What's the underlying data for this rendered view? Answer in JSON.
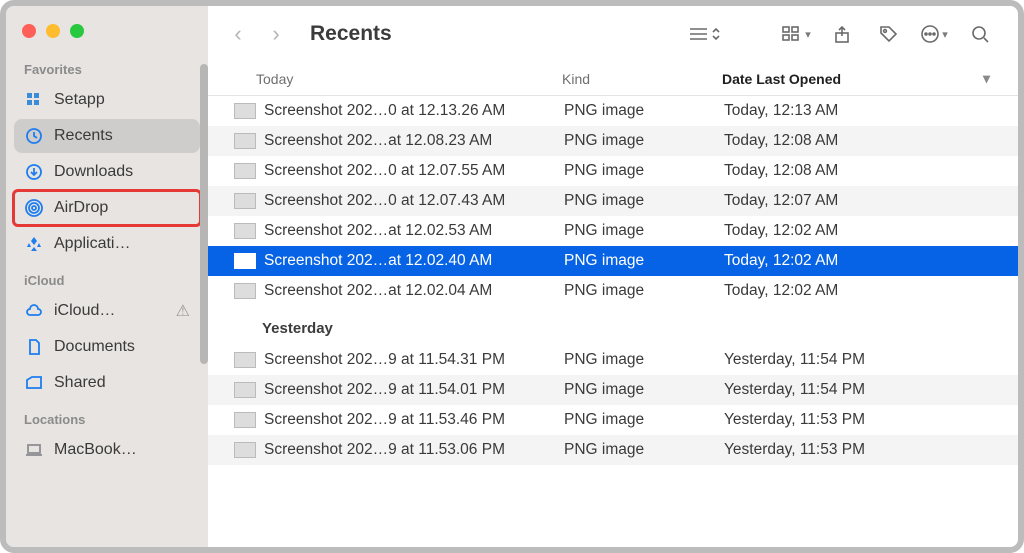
{
  "window_title": "Recents",
  "sidebar": {
    "sections": [
      {
        "label": "Favorites",
        "items": [
          {
            "icon": "setapp",
            "label": "Setapp",
            "active": false
          },
          {
            "icon": "clock",
            "label": "Recents",
            "active": true
          },
          {
            "icon": "download",
            "label": "Downloads",
            "active": false
          },
          {
            "icon": "airdrop",
            "label": "AirDrop",
            "active": false,
            "highlight": true
          },
          {
            "icon": "apps",
            "label": "Applicati…",
            "active": false
          }
        ]
      },
      {
        "label": "iCloud",
        "items": [
          {
            "icon": "cloud",
            "label": "iCloud…",
            "active": false,
            "warn": true
          },
          {
            "icon": "doc",
            "label": "Documents",
            "active": false
          },
          {
            "icon": "shared",
            "label": "Shared",
            "active": false
          }
        ]
      },
      {
        "label": "Locations",
        "items": [
          {
            "icon": "laptop",
            "label": "MacBook…",
            "active": false,
            "gray": true
          }
        ]
      }
    ]
  },
  "columns": {
    "name": "Today",
    "kind": "Kind",
    "date": "Date Last Opened"
  },
  "groups": [
    {
      "label": "Today",
      "show_label": false,
      "rows": [
        {
          "name": "Screenshot 202…0 at 12.13.26 AM",
          "kind": "PNG image",
          "date": "Today, 12:13 AM",
          "sel": false
        },
        {
          "name": "Screenshot 202…at 12.08.23 AM",
          "kind": "PNG image",
          "date": "Today, 12:08 AM",
          "sel": false
        },
        {
          "name": "Screenshot 202…0 at 12.07.55 AM",
          "kind": "PNG image",
          "date": "Today, 12:08 AM",
          "sel": false
        },
        {
          "name": "Screenshot 202…0 at 12.07.43 AM",
          "kind": "PNG image",
          "date": "Today, 12:07 AM",
          "sel": false
        },
        {
          "name": "Screenshot 202…at 12.02.53 AM",
          "kind": "PNG image",
          "date": "Today, 12:02 AM",
          "sel": false
        },
        {
          "name": "Screenshot 202…at 12.02.40 AM",
          "kind": "PNG image",
          "date": "Today, 12:02 AM",
          "sel": true
        },
        {
          "name": "Screenshot 202…at 12.02.04 AM",
          "kind": "PNG image",
          "date": "Today, 12:02 AM",
          "sel": false
        }
      ]
    },
    {
      "label": "Yesterday",
      "show_label": true,
      "rows": [
        {
          "name": "Screenshot 202…9 at 11.54.31 PM",
          "kind": "PNG image",
          "date": "Yesterday, 11:54 PM",
          "sel": false
        },
        {
          "name": "Screenshot 202…9 at 11.54.01 PM",
          "kind": "PNG image",
          "date": "Yesterday, 11:54 PM",
          "sel": false
        },
        {
          "name": "Screenshot 202…9 at 11.53.46 PM",
          "kind": "PNG image",
          "date": "Yesterday, 11:53 PM",
          "sel": false
        },
        {
          "name": "Screenshot 202…9 at 11.53.06 PM",
          "kind": "PNG image",
          "date": "Yesterday, 11:53 PM",
          "sel": false
        }
      ]
    }
  ]
}
